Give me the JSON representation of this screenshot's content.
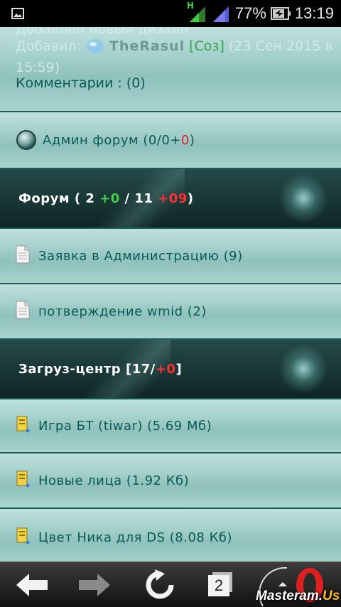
{
  "status_bar": {
    "battery": "77%",
    "time": "13:19",
    "network_letter": "H",
    "icons": [
      "image-icon",
      "signal-h-icon",
      "signal-icon",
      "battery-icon"
    ]
  },
  "news": {
    "title_partial": "Добавлен новый дизайн",
    "added_by_label": "Добавил:",
    "author": "TheRasul",
    "role": "[Соз]",
    "date": "(23 Сен 2015 в",
    "time": "15:59)",
    "comments": "Комментарии : (0)"
  },
  "admin_forum": {
    "label": "Админ форум",
    "count_prefix": "(0/0+",
    "count_new": "0",
    "count_suffix": ")"
  },
  "forum_header": {
    "label": "Форум",
    "open": "( 2",
    "new_topics": "+0",
    "sep": "/ 11",
    "new_posts": "+09",
    "close": ")"
  },
  "forum_items": [
    {
      "label": "Заявка в Администрацию",
      "count": "(9)"
    },
    {
      "label": "потверждение wmid",
      "count": "(2)"
    }
  ],
  "downloads_header": {
    "label": "Загруз-центр",
    "open": "[17/",
    "new_count": "+0",
    "close": "]"
  },
  "downloads": [
    {
      "label": "Игра БТ (tiwar)",
      "size": "(5.69 Мб)"
    },
    {
      "label": "Новые лица",
      "size": "(1.92 Кб)"
    },
    {
      "label": "Цвет Ника для DS",
      "size": "(8.08 Кб)"
    }
  ],
  "browser_bar": {
    "tab_count": "2",
    "watermark_main": "Masteram.",
    "watermark_accent": "Us"
  },
  "colors": {
    "row_text": "#0a5a55",
    "header_bg": "#1b3939",
    "new_green": "#3fbf3a",
    "new_red": "#e02020"
  }
}
